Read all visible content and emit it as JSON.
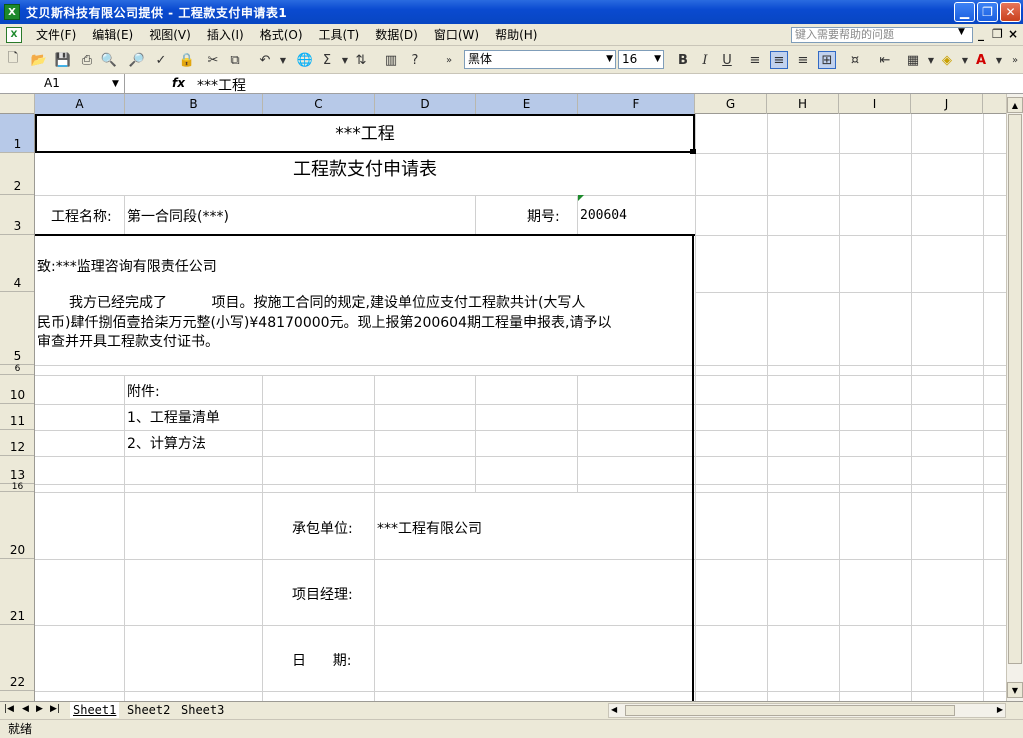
{
  "window": {
    "title": "艾贝斯科技有限公司提供 - 工程款支付申请表1",
    "app_icon": "excel-icon"
  },
  "menubar": {
    "items": [
      "文件(F)",
      "编辑(E)",
      "视图(V)",
      "插入(I)",
      "格式(O)",
      "工具(T)",
      "数据(D)",
      "窗口(W)",
      "帮助(H)"
    ],
    "help_placeholder": "键入需要帮助的问题"
  },
  "toolbar": {
    "font": "黑体",
    "size": "16"
  },
  "formula_bar": {
    "name_box": "A1",
    "fx": "fx",
    "value": "***工程"
  },
  "columns": [
    "A",
    "B",
    "C",
    "D",
    "E",
    "F",
    "G",
    "H",
    "I",
    "J"
  ],
  "rows": [
    "1",
    "2",
    "3",
    "4",
    "5",
    "6",
    "10",
    "11",
    "12",
    "13",
    "16",
    "20",
    "21",
    "22"
  ],
  "cells": {
    "r1": "***工程",
    "title": "工程款支付申请表",
    "project_label": "工程名称:",
    "project_value": "第一合同段(***)",
    "period_label": "期号:",
    "period_value": "200604",
    "to": "致:***监理咨询有限责任公司",
    "body_line1": "我方已经完成了          项目。按施工合同的规定,建设单位应支付工程款共计(大写人",
    "body_line2": "民币)肆仟捌佰壹拾柒万元整(小写)¥48170000元。现上报第200604期工程量申报表,请予以",
    "body_line3": "审查并开具工程款支付证书。",
    "attach_label": "附件:",
    "attach_1": "1、工程量清单",
    "attach_2": "2、计算方法",
    "contractor_label": "承包单位:",
    "contractor_value": "***工程有限公司",
    "manager_label": "项目经理:",
    "date_label": "日      期:"
  },
  "sheets": [
    "Sheet1",
    "Sheet2",
    "Sheet3"
  ],
  "status": "就绪"
}
